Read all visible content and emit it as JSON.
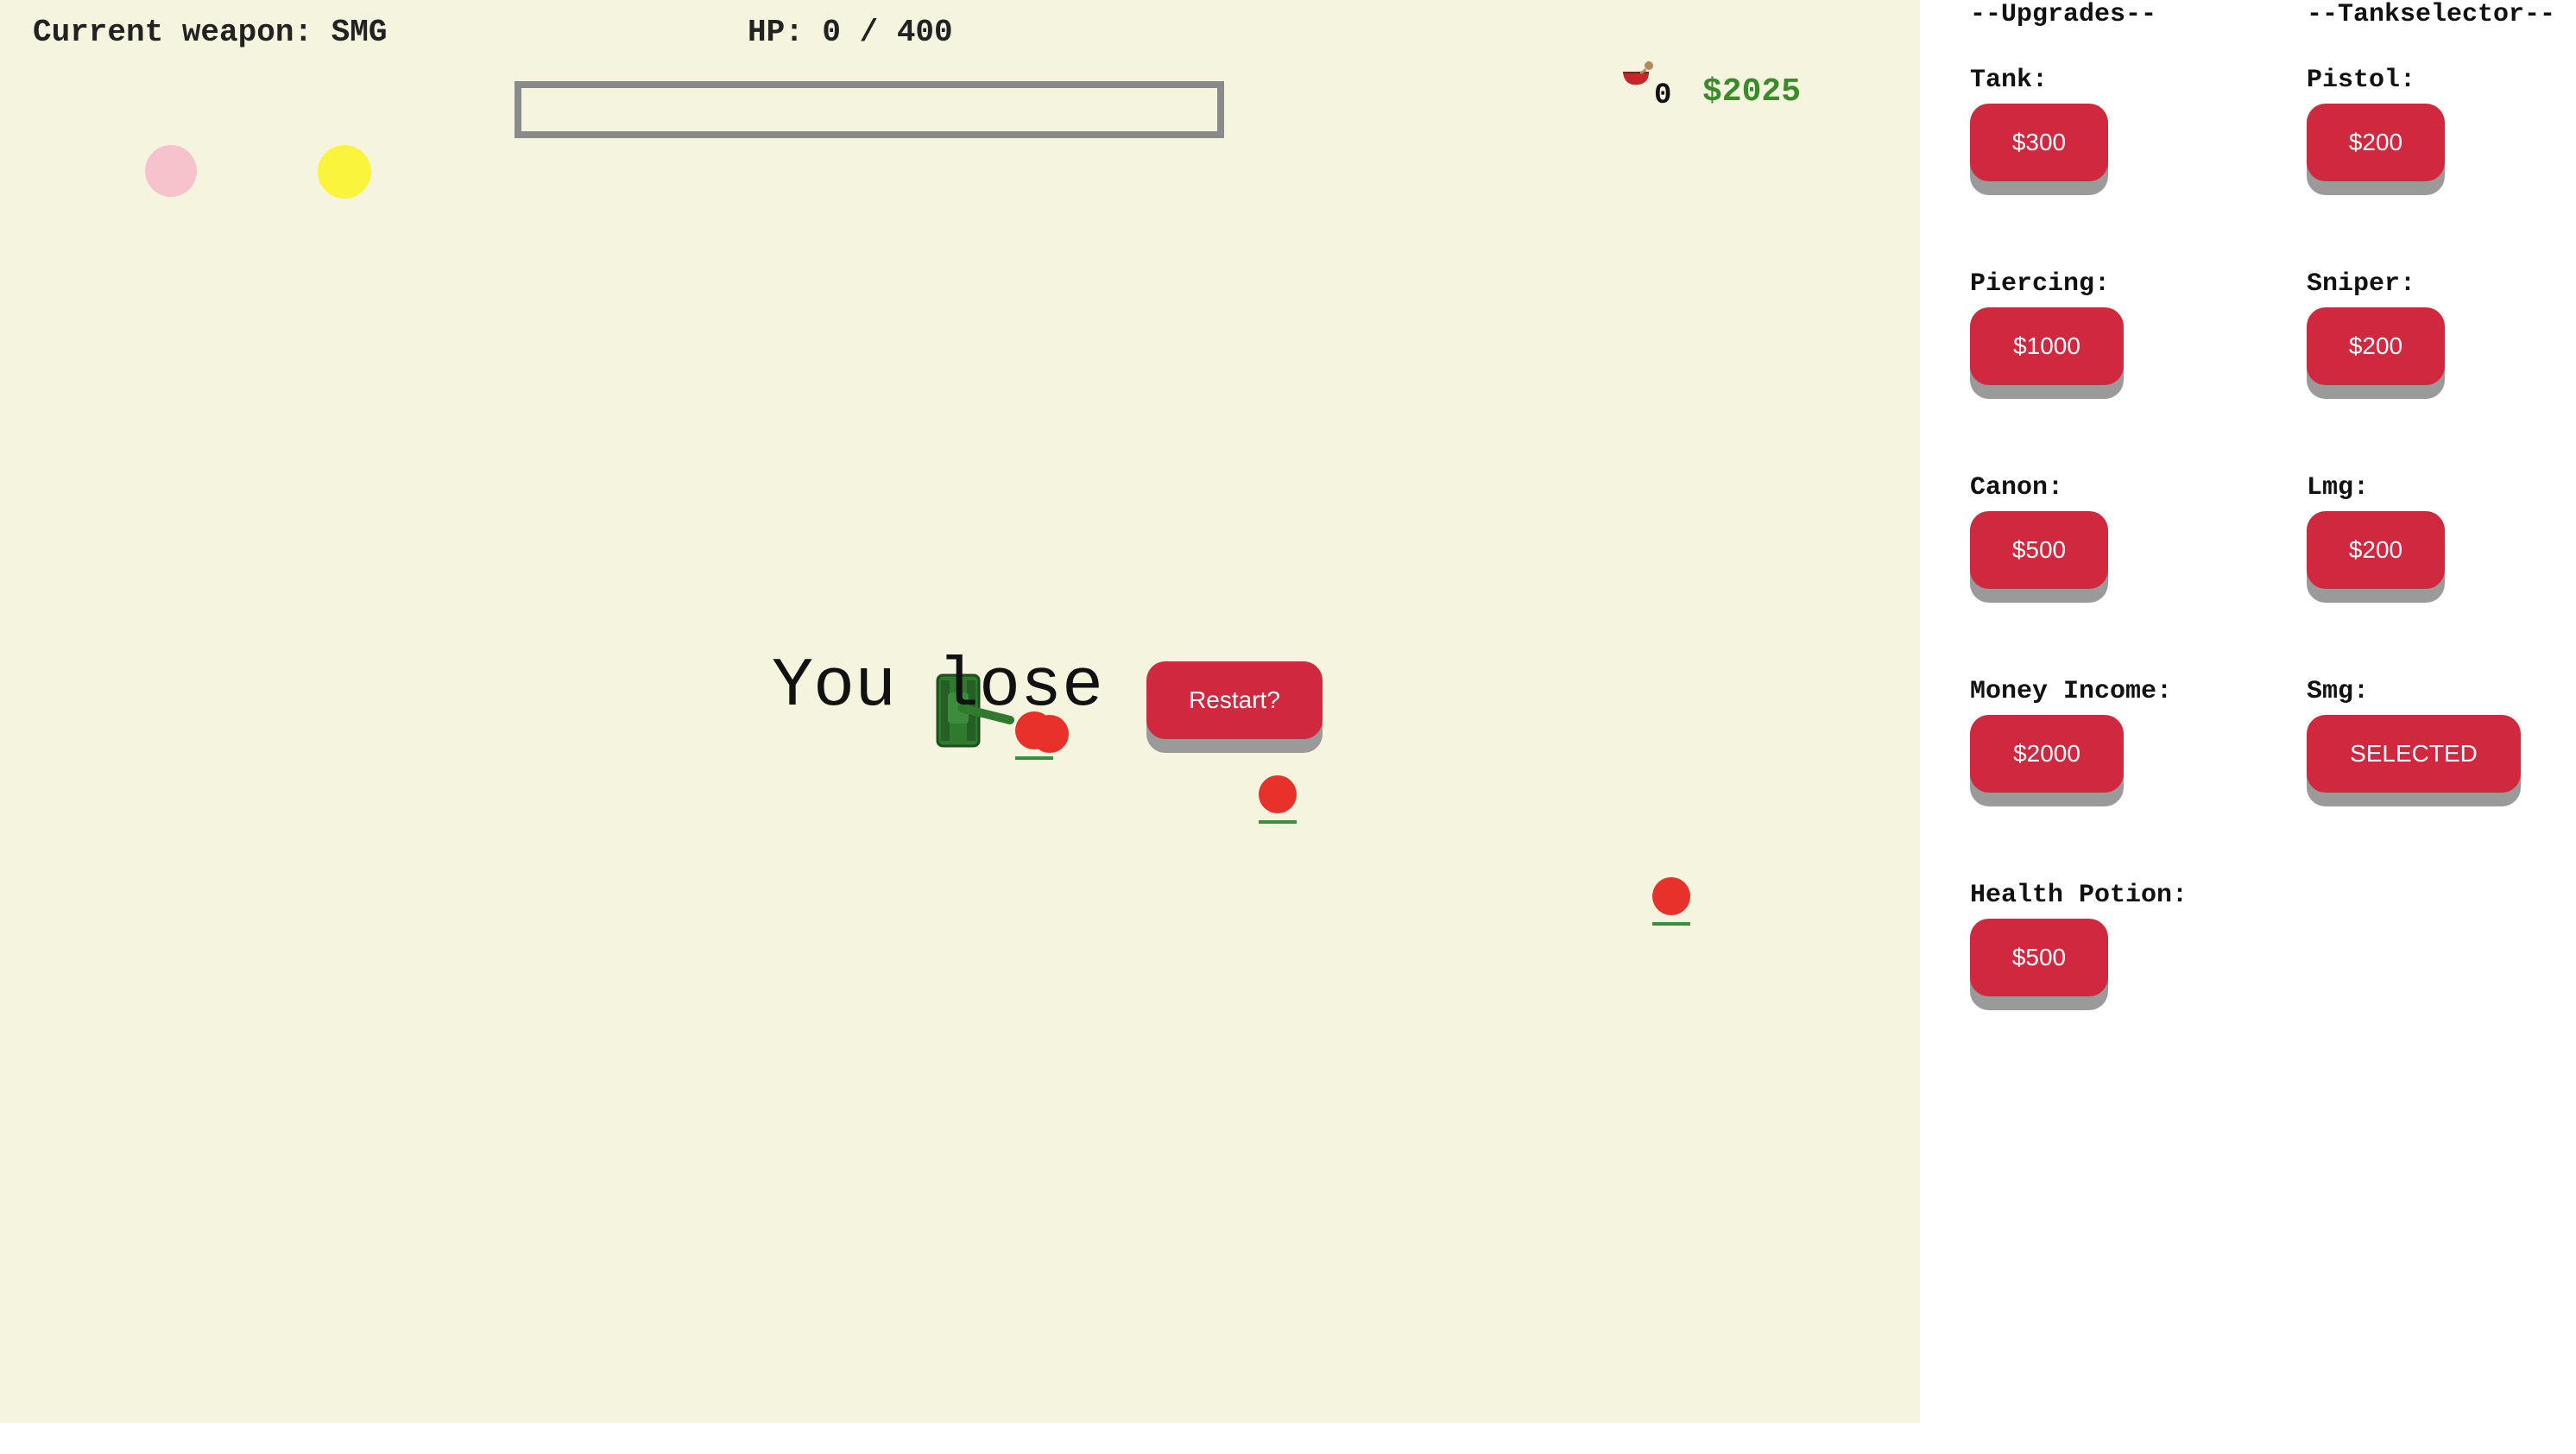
{
  "hud": {
    "weapon_text": "Current weapon: SMG",
    "hp_text": "HP: 0 / 400",
    "hp_fraction": 0,
    "potion_count": "0",
    "money": "$2025"
  },
  "overlay": {
    "lose_text": "You lose",
    "restart_label": "Restart?"
  },
  "shop": {
    "upgrades_heading": "--Upgrades--",
    "tankselector_heading": "--Tankselector--",
    "upgrades": [
      {
        "label": "Tank:",
        "button": "$300"
      },
      {
        "label": "Piercing:",
        "button": "$1000"
      },
      {
        "label": "Canon:",
        "button": "$500"
      },
      {
        "label": "Money Income:",
        "button": "$2000"
      },
      {
        "label": "Health Potion:",
        "button": "$500"
      }
    ],
    "tanks": [
      {
        "label": "Pistol:",
        "button": "$200"
      },
      {
        "label": "Sniper:",
        "button": "$200"
      },
      {
        "label": "Lmg:",
        "button": "$200"
      },
      {
        "label": "Smg:",
        "button": "SELECTED"
      }
    ]
  },
  "colors": {
    "game_bg": "#f5f4de",
    "button": "#d0293f",
    "button_shadow": "#9a9a9a",
    "money": "#3b8a2c",
    "enemy": "#e8312a",
    "tank": "#2f7a2f"
  },
  "icons": {
    "potion": "health-potion-icon"
  }
}
